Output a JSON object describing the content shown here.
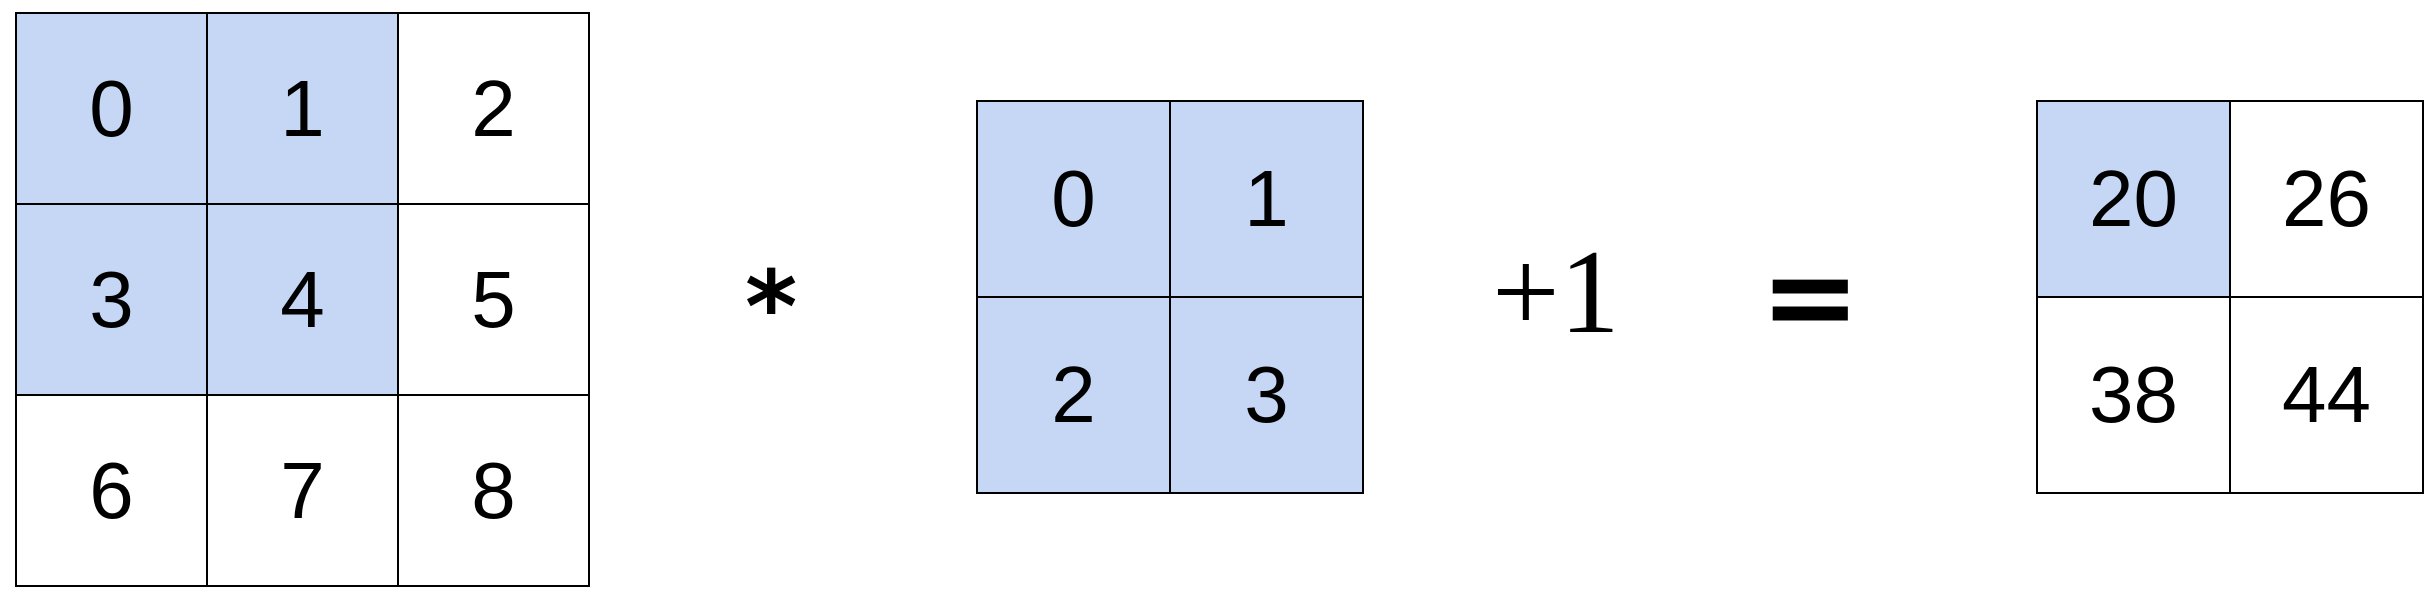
{
  "highlight_color": "#c5d7f5",
  "input": {
    "cells": [
      {
        "value": "0",
        "highlighted": true
      },
      {
        "value": "1",
        "highlighted": true
      },
      {
        "value": "2",
        "highlighted": false
      },
      {
        "value": "3",
        "highlighted": true
      },
      {
        "value": "4",
        "highlighted": true
      },
      {
        "value": "5",
        "highlighted": false
      },
      {
        "value": "6",
        "highlighted": false
      },
      {
        "value": "7",
        "highlighted": false
      },
      {
        "value": "8",
        "highlighted": false
      }
    ]
  },
  "operators": {
    "conv": "*",
    "bias": "+1",
    "equals": "="
  },
  "kernel": {
    "cells": [
      {
        "value": "0",
        "highlighted": true
      },
      {
        "value": "1",
        "highlighted": true
      },
      {
        "value": "2",
        "highlighted": true
      },
      {
        "value": "3",
        "highlighted": true
      }
    ]
  },
  "output": {
    "cells": [
      {
        "value": "20",
        "highlighted": true
      },
      {
        "value": "26",
        "highlighted": false
      },
      {
        "value": "38",
        "highlighted": false
      },
      {
        "value": "44",
        "highlighted": false
      }
    ]
  }
}
